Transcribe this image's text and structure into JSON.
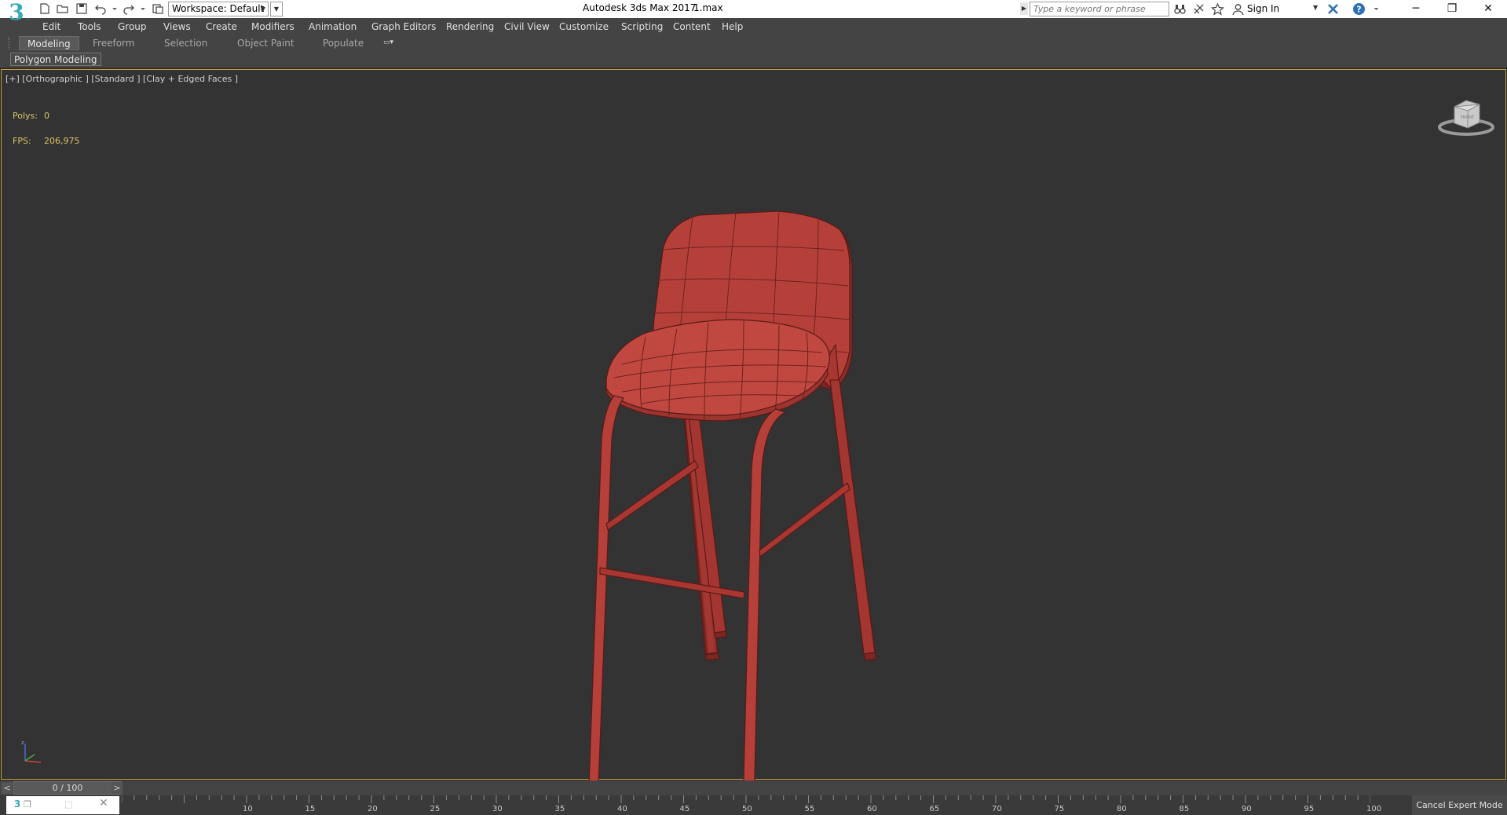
{
  "app": {
    "logo_text": "3",
    "title": "Autodesk 3ds Max 2017",
    "file_name": "1.max"
  },
  "quick_access": {
    "workspace_label": "Workspace: Default",
    "icons": [
      "new-file-icon",
      "open-file-icon",
      "save-icon",
      "undo-icon",
      "redo-icon",
      "project-folder-icon"
    ]
  },
  "search": {
    "placeholder": "Type a keyword or phrase"
  },
  "account": {
    "sign_in_label": "Sign In"
  },
  "menu": {
    "items": [
      "Edit",
      "Tools",
      "Group",
      "Views",
      "Create",
      "Modifiers",
      "Animation",
      "Graph Editors",
      "Rendering",
      "Civil View",
      "Customize",
      "Scripting",
      "Content",
      "Help"
    ]
  },
  "ribbon": {
    "tabs": [
      "Modeling",
      "Freeform",
      "Selection",
      "Object Paint",
      "Populate"
    ],
    "active_tab": "Modeling",
    "panel_label": "Polygon Modeling"
  },
  "viewport": {
    "label": "[+] [Orthographic ] [Standard ] [Clay + Edged Faces ]",
    "stats": {
      "polys_label": "Polys:",
      "polys_value": "0",
      "fps_label": "FPS:",
      "fps_value": "206,975"
    },
    "model_color": "#b5403a",
    "border_color": "#c0a23a"
  },
  "time_slider": {
    "frame_display": "0 / 100",
    "prev_label": "<",
    "next_label": ">"
  },
  "track_bar": {
    "ticks": [
      "10",
      "15",
      "20",
      "25",
      "30",
      "35",
      "40",
      "45",
      "50",
      "55",
      "60",
      "65",
      "70",
      "75",
      "80",
      "85",
      "90",
      "95",
      "100"
    ]
  },
  "status": {
    "cancel_expert_mode": "Cancel Expert Mode"
  }
}
